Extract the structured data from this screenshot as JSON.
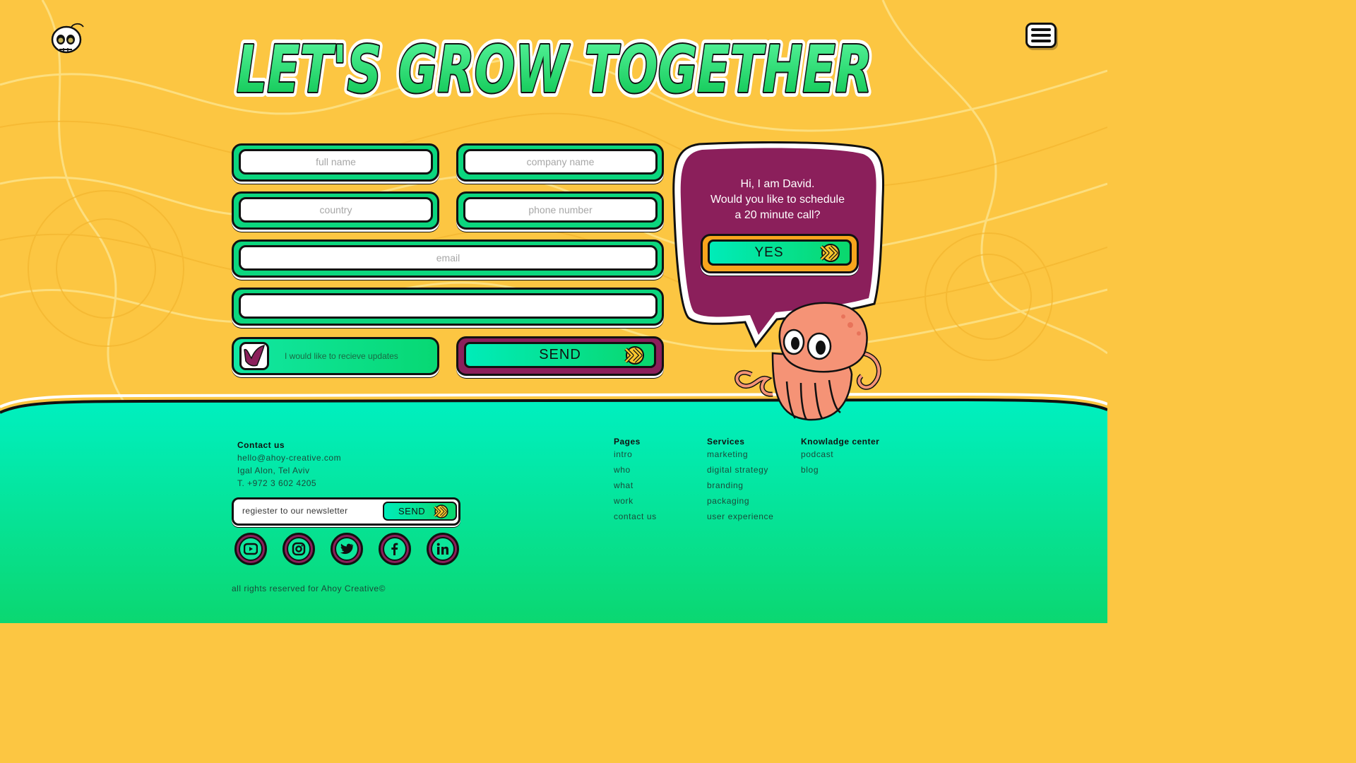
{
  "header": {
    "headline": "LET'S GROW TOGETHER",
    "logo_icon": "skull-icon",
    "menu_icon": "hamburger-menu-icon"
  },
  "form": {
    "full_name_placeholder": "full name",
    "company_placeholder": "company name",
    "country_placeholder": "country",
    "phone_placeholder": "phone number",
    "email_placeholder": "email",
    "message_placeholder": "",
    "updates_label": "I would like to recieve updates",
    "updates_checked": true,
    "send_label": "SEND"
  },
  "bubble": {
    "line1": "Hi,  I am David.",
    "line2": "Would you like to schedule",
    "line3": "a 20 minute call?",
    "yes_label": "YES"
  },
  "footer": {
    "contact_title": "Contact us",
    "email": "hello@ahoy-creative.com",
    "address": "Igal Alon, Tel Aviv",
    "phone": "T. +972 3 602 4205",
    "newsletter_placeholder": "regiester to our newsletter",
    "newsletter_send": "SEND",
    "social": [
      "youtube-icon",
      "instagram-icon",
      "twitter-icon",
      "facebook-icon",
      "linkedin-icon"
    ],
    "copyright": "all rights reserved for Ahoy Creative©",
    "pages": {
      "title": "Pages",
      "items": [
        "intro",
        "who",
        "what",
        "work",
        "contact us"
      ]
    },
    "services": {
      "title": "Services",
      "items": [
        "marketing",
        "digital strategy",
        "branding",
        "packaging",
        "user experience"
      ]
    },
    "knowledge": {
      "title": "Knowladge center",
      "items": [
        "podcast",
        "blog"
      ]
    }
  },
  "colors": {
    "background_yellow": "#fcc642",
    "accent_green": "#0bd67e",
    "footer_teal": "#00f0c0",
    "bubble_purple": "#8b1f5b",
    "yes_orange": "#f7a51d",
    "octopus_salmon": "#f59376"
  }
}
